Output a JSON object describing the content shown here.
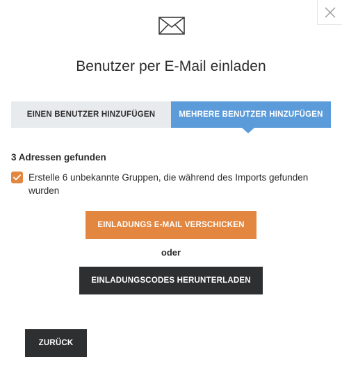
{
  "dialog": {
    "title": "Benutzer per E-Mail einladen",
    "icon": "envelope-icon",
    "close_icon": "close-icon"
  },
  "tabs": [
    {
      "label": "EINEN BENUTZER HINZUFÜGEN",
      "active": false
    },
    {
      "label": "MEHRERE BENUTZER HINZUFÜGEN",
      "active": true
    }
  ],
  "import": {
    "found_text": "3 Adressen gefunden",
    "checkbox_checked": true,
    "checkbox_label": "Erstelle 6 unbekannte Gruppen, die während des Imports gefunden wurden"
  },
  "actions": {
    "send_label": "EINLADUNGS E-MAIL VERSCHICKEN",
    "or_label": "oder",
    "download_label": "EINLADUNGSCODES HERUNTERLADEN",
    "back_label": "ZURÜCK"
  },
  "colors": {
    "accent_orange": "#e28640",
    "accent_blue": "#5b9bd9",
    "dark_button": "#2d2f31",
    "tab_inactive": "#e8ebee"
  }
}
